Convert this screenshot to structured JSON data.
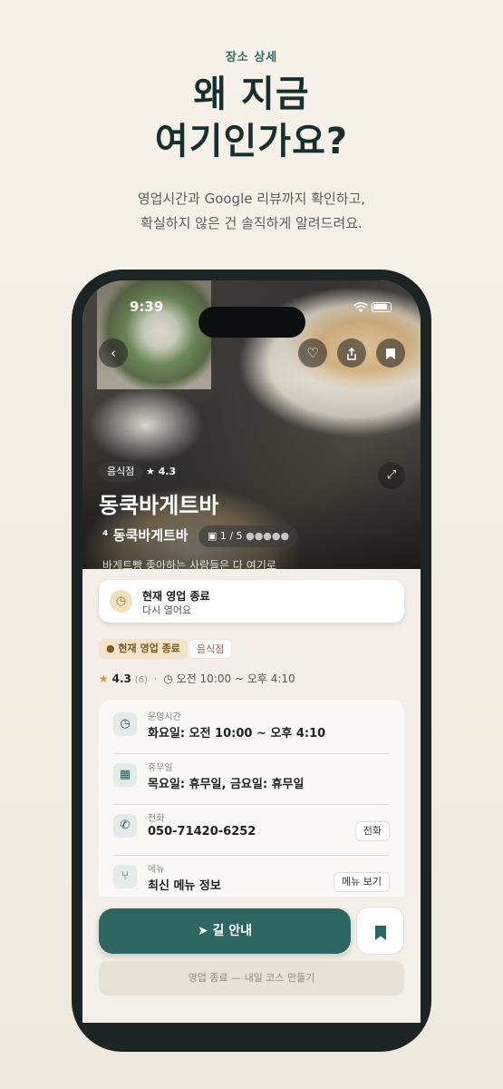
{
  "hero": {
    "eyebrow": "장소 상세",
    "headline_line1": "왜 지금",
    "headline_line2": "여기인가요?",
    "sub_line1": "영업시간과 Google 리뷰까지 확인하고,",
    "sub_line2": "확실하지 않은 건 솔직하게 알려드려요."
  },
  "status_bar": {
    "time": "9:39"
  },
  "photo": {
    "category_chip": "음식점",
    "rating": "★ 4.3",
    "title": "동쿡바게트바",
    "subtitle": "⁴ 동쿡바게트바",
    "counter": "1 / 5",
    "dots": "●●●●●",
    "caption": "바게트빵 좋아하는 사람들은 다 여기로"
  },
  "status_card": {
    "title": "현재 영업 종료",
    "subtitle": "다시 열어요"
  },
  "chips": {
    "closed": "● 현재 영업 종료",
    "category": "음식점"
  },
  "meta": {
    "rating": "4.3",
    "review_count": "(6)",
    "separator": "·",
    "hours": "오전 10:00 ~ 오후 4:10"
  },
  "info_rows": [
    {
      "label": "운영시간",
      "value": "화요일: 오전 10:00 ~ 오후 4:10",
      "icon": "clock-icon"
    },
    {
      "label": "휴무일",
      "value": "목요일: 휴무일, 금요일: 휴무일",
      "icon": "calendar-icon"
    },
    {
      "label": "전화",
      "value": "050-71420-6252",
      "icon": "phone-icon",
      "action": "전화"
    },
    {
      "label": "메뉴",
      "value": "최신 메뉴 정보",
      "icon": "utensils-icon",
      "action": "메뉴 보기"
    }
  ],
  "actions": {
    "navigate": "길 안내",
    "course": "영업 종료 — 내일 코스 만들기"
  },
  "colors": {
    "accent": "#2d6660",
    "background": "#f3efe8"
  }
}
